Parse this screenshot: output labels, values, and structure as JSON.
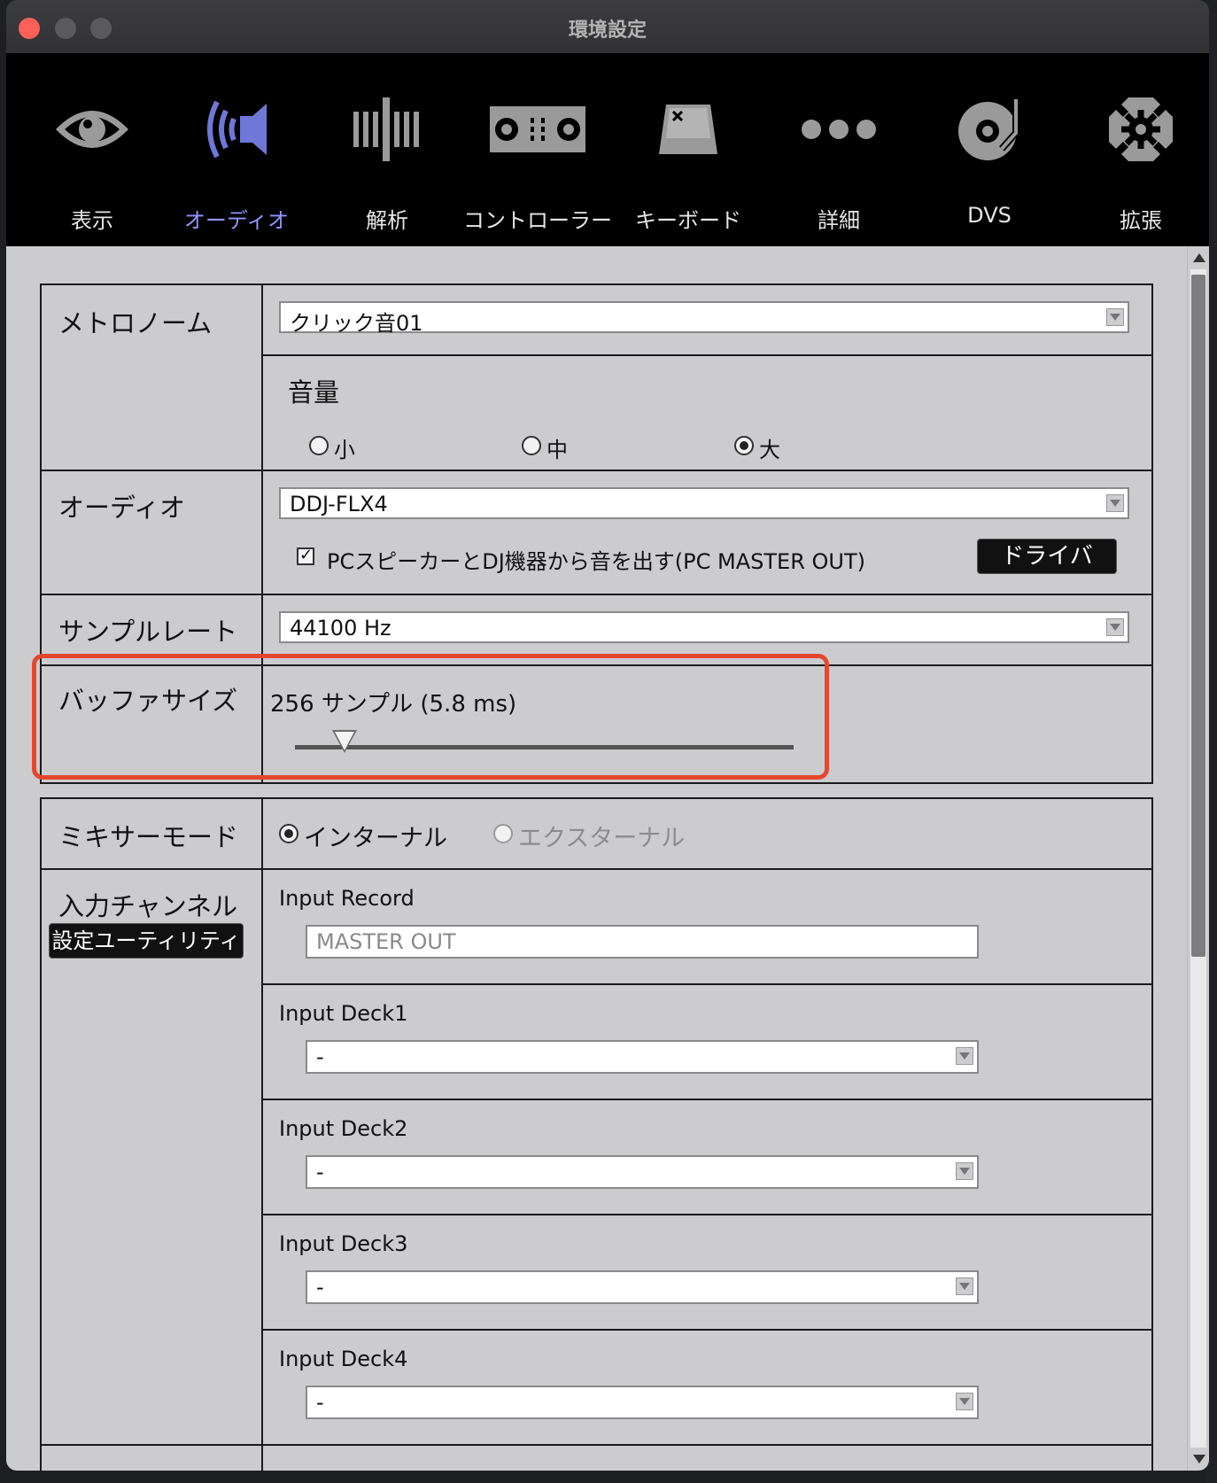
{
  "window": {
    "title": "環境設定"
  },
  "toolbar": {
    "items": [
      {
        "label": "表示",
        "icon": "eye-icon"
      },
      {
        "label": "オーディオ",
        "icon": "speaker-icon",
        "active": true
      },
      {
        "label": "解析",
        "icon": "waveform-icon"
      },
      {
        "label": "コントローラー",
        "icon": "controller-icon"
      },
      {
        "label": "キーボード",
        "icon": "keyboard-key-icon"
      },
      {
        "label": "詳細",
        "icon": "more-dots-icon"
      },
      {
        "label": "DVS",
        "icon": "turntable-icon"
      },
      {
        "label": "拡張",
        "icon": "gear-expand-icon"
      }
    ],
    "active_color": "#8d97ff"
  },
  "metronome": {
    "label": "メトロノーム",
    "sound_value": "クリック音01",
    "volume_label": "音量",
    "volume_options": [
      "小",
      "中",
      "大"
    ],
    "volume_selected": "大"
  },
  "audio": {
    "label": "オーディオ",
    "device_value": "DDJ-FLX4",
    "pc_master_out_label": "PCスピーカーとDJ機器から音を出す(PC MASTER OUT)",
    "pc_master_out_checked": true,
    "driver_button": "ドライバ"
  },
  "sample_rate": {
    "label": "サンプルレート",
    "value": "44100 Hz"
  },
  "buffer_size": {
    "label": "バッファサイズ",
    "value_text": "256 サンプル (5.8 ms)",
    "slider_fraction": 0.1,
    "highlight_color": "#e5472e"
  },
  "mixer_mode": {
    "label": "ミキサーモード",
    "options": [
      "インターナル",
      "エクスターナル"
    ],
    "selected": "インターナル"
  },
  "input_channels": {
    "label": "入力チャンネル",
    "utility_button": "設定ユーティリティ",
    "rows": [
      {
        "label": "Input Record",
        "value": "MASTER OUT"
      },
      {
        "label": "Input Deck1",
        "value": "-"
      },
      {
        "label": "Input Deck2",
        "value": "-"
      },
      {
        "label": "Input Deck3",
        "value": "-"
      },
      {
        "label": "Input Deck4",
        "value": "-"
      }
    ]
  }
}
